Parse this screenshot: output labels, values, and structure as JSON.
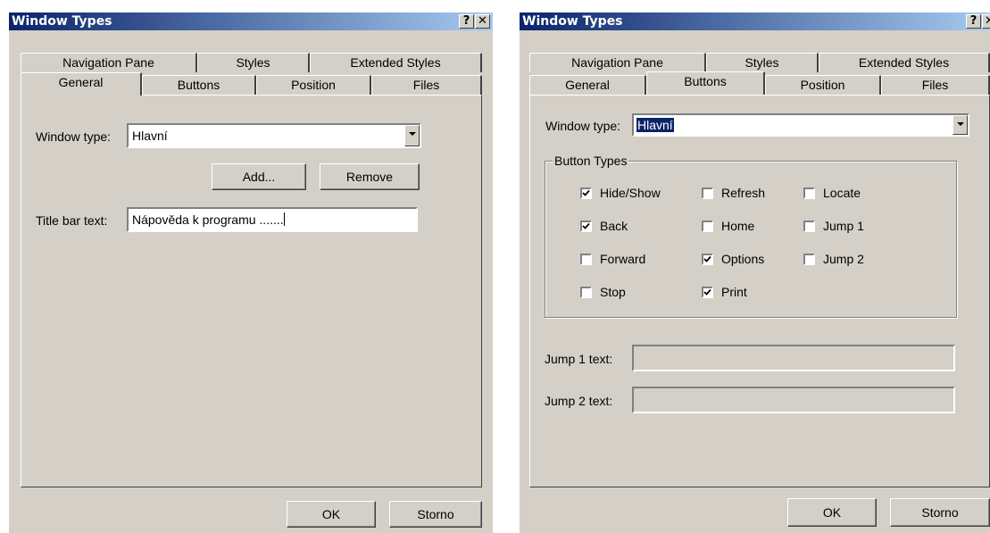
{
  "dialog1": {
    "title": "Window Types",
    "help_glyph": "?",
    "close_glyph": "✕",
    "tabs_row1": [
      "Navigation Pane",
      "Styles",
      "Extended Styles"
    ],
    "tabs_row2": [
      "General",
      "Buttons",
      "Position",
      "Files"
    ],
    "active_tab": "General",
    "window_type_label": "Window type:",
    "window_type_value": "Hlavní",
    "add_label": "Add...",
    "remove_label": "Remove",
    "title_bar_label": "Title bar text:",
    "title_bar_value": "Nápověda k programu .......",
    "ok_label": "OK",
    "cancel_label": "Storno"
  },
  "dialog2": {
    "title": "Window Types",
    "help_glyph": "?",
    "close_glyph": "✕",
    "tabs_row1": [
      "Navigation Pane",
      "Styles",
      "Extended Styles"
    ],
    "tabs_row2": [
      "General",
      "Buttons",
      "Position",
      "Files"
    ],
    "active_tab": "Buttons",
    "window_type_label": "Window type:",
    "window_type_value": "Hlavní",
    "group_title": "Button Types",
    "checkboxes": [
      {
        "label": "Hide/Show",
        "checked": true
      },
      {
        "label": "Refresh",
        "checked": false
      },
      {
        "label": "Locate",
        "checked": false
      },
      {
        "label": "Back",
        "checked": true
      },
      {
        "label": "Home",
        "checked": false
      },
      {
        "label": "Jump 1",
        "checked": false
      },
      {
        "label": "Forward",
        "checked": false
      },
      {
        "label": "Options",
        "checked": true
      },
      {
        "label": "Jump 2",
        "checked": false
      },
      {
        "label": "Stop",
        "checked": false
      },
      {
        "label": "Print",
        "checked": true
      }
    ],
    "jump1_label": "Jump 1 text:",
    "jump1_value": "",
    "jump2_label": "Jump 2 text:",
    "jump2_value": "",
    "ok_label": "OK",
    "cancel_label": "Storno"
  },
  "colors": {
    "titlebar_start": "#0a246a",
    "titlebar_end": "#a6caf0",
    "dialog_face": "#d4d0c8",
    "selection": "#0a246a"
  }
}
